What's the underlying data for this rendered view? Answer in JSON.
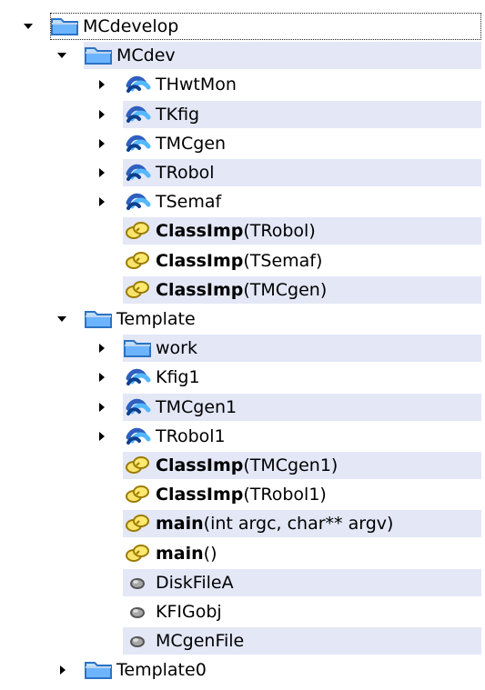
{
  "tree": {
    "nodes": [
      {
        "id": "mcdevelop",
        "icon": "folder-icon",
        "toggle": "expanded",
        "bold": "",
        "text": "MCdevelop"
      },
      {
        "id": "mcdev",
        "icon": "folder-icon",
        "toggle": "expanded",
        "bold": "",
        "text": "MCdev"
      },
      {
        "id": "thwtmon",
        "icon": "class-icon",
        "toggle": "collapsed",
        "bold": "",
        "text": "THwtMon"
      },
      {
        "id": "tkfig",
        "icon": "class-icon",
        "toggle": "collapsed",
        "bold": "",
        "text": "TKfig"
      },
      {
        "id": "tmcgen",
        "icon": "class-icon",
        "toggle": "collapsed",
        "bold": "",
        "text": "TMCgen"
      },
      {
        "id": "trobol",
        "icon": "class-icon",
        "toggle": "collapsed",
        "bold": "",
        "text": "TRobol"
      },
      {
        "id": "tsemaf",
        "icon": "class-icon",
        "toggle": "collapsed",
        "bold": "",
        "text": "TSemaf"
      },
      {
        "id": "classimp-trobol",
        "icon": "function-icon",
        "toggle": "none",
        "bold": "ClassImp",
        "text": "(TRobol)"
      },
      {
        "id": "classimp-tsemaf",
        "icon": "function-icon",
        "toggle": "none",
        "bold": "ClassImp",
        "text": "(TSemaf)"
      },
      {
        "id": "classimp-tmcgen",
        "icon": "function-icon",
        "toggle": "none",
        "bold": "ClassImp",
        "text": "(TMCgen)"
      },
      {
        "id": "template",
        "icon": "folder-icon",
        "toggle": "expanded",
        "bold": "",
        "text": "Template"
      },
      {
        "id": "work",
        "icon": "folder-icon",
        "toggle": "collapsed",
        "bold": "",
        "text": "work"
      },
      {
        "id": "kfig1",
        "icon": "class-icon",
        "toggle": "collapsed",
        "bold": "",
        "text": "Kfig1"
      },
      {
        "id": "tmcgen1",
        "icon": "class-icon",
        "toggle": "collapsed",
        "bold": "",
        "text": "TMCgen1"
      },
      {
        "id": "trobol1",
        "icon": "class-icon",
        "toggle": "collapsed",
        "bold": "",
        "text": "TRobol1"
      },
      {
        "id": "classimp-tmcgen1",
        "icon": "function-icon",
        "toggle": "none",
        "bold": "ClassImp",
        "text": "(TMCgen1)"
      },
      {
        "id": "classimp-trobol1",
        "icon": "function-icon",
        "toggle": "none",
        "bold": "ClassImp",
        "text": "(TRobol1)"
      },
      {
        "id": "main-args",
        "icon": "function-icon",
        "toggle": "none",
        "bold": "main",
        "text": "(int argc, char** argv)"
      },
      {
        "id": "main-noargs",
        "icon": "function-icon",
        "toggle": "none",
        "bold": "main",
        "text": "()"
      },
      {
        "id": "diskfilea",
        "icon": "variable-icon",
        "toggle": "none",
        "bold": "",
        "text": "DiskFileA"
      },
      {
        "id": "kfigobj",
        "icon": "variable-icon",
        "toggle": "none",
        "bold": "",
        "text": "KFIGobj"
      },
      {
        "id": "mcgenfile",
        "icon": "variable-icon",
        "toggle": "none",
        "bold": "",
        "text": "MCgenFile"
      },
      {
        "id": "template0",
        "icon": "folder-icon",
        "toggle": "collapsed",
        "bold": "",
        "text": "Template0"
      }
    ]
  },
  "colors": {
    "band": "#e3e7f6",
    "folder": "#5aa0e0",
    "class": "#1b6fd0",
    "function": "#e6c200",
    "variable": "#8a8a8a"
  }
}
